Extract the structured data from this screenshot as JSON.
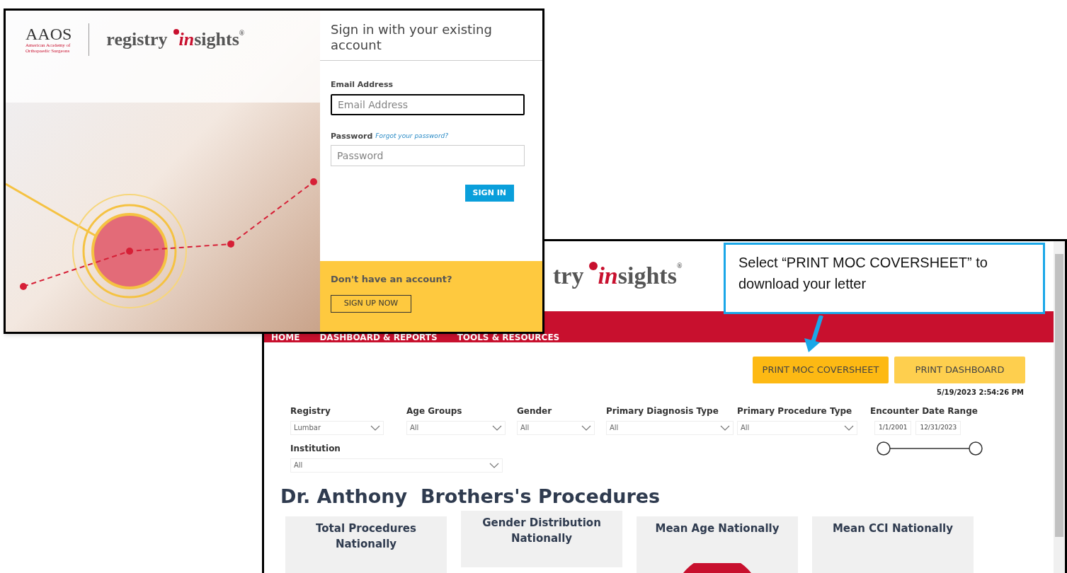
{
  "login_window": {
    "logo": {
      "org": "AAOS",
      "org_lines": [
        "American Academy of",
        "Orthopaedic Surgeons"
      ],
      "product": [
        "registry",
        "in",
        "sights"
      ],
      "mark": "®"
    },
    "title": "Sign in with your existing account",
    "email": {
      "label": "Email Address",
      "placeholder": "Email Address",
      "focused": true
    },
    "password": {
      "label": "Password",
      "link": "Forgot your password?",
      "placeholder": "Password",
      "focused": false
    },
    "sign_in_button": "SIGN IN",
    "signup": {
      "prompt": "Don't have an account?",
      "button": "SIGN UP NOW"
    }
  },
  "dashboard_window": {
    "logo": {
      "product": [
        "try",
        "in",
        "sights"
      ],
      "mark": "®"
    },
    "nav": [
      {
        "label": "HOME"
      },
      {
        "label": "DASHBOARD & REPORTS"
      },
      {
        "label": "TOOLS & RESOURCES"
      }
    ],
    "buttons": [
      {
        "label": "PRINT MOC COVERSHEET",
        "selected": true
      },
      {
        "label": "PRINT DASHBOARD",
        "selected": false
      }
    ],
    "timestamp": "5/19/2023 2:54:26 PM",
    "filters": [
      {
        "label": "Registry",
        "value": "Lumbar"
      },
      {
        "label": "Age Groups",
        "value": "All"
      },
      {
        "label": "Gender",
        "value": "All"
      },
      {
        "label": "Primary Diagnosis Type",
        "value": "All"
      },
      {
        "label": "Primary Procedure Type",
        "value": "All"
      }
    ],
    "date_range": {
      "label": "Encounter Date Range",
      "start": "1/1/2001",
      "end": "12/31/2023",
      "handles": [
        {
          "level": 0
        },
        {
          "level": 1
        }
      ]
    },
    "institution": {
      "label": "Institution",
      "value": "All"
    },
    "heading": "Dr. Anthony  Brothers's Procedures",
    "cards": [
      {
        "title": "Total Procedures Nationally",
        "kind": "text"
      },
      {
        "title": "Gender Distribution Nationally",
        "kind": "text"
      },
      {
        "title": "Mean Age Nationally",
        "kind": "gauge"
      },
      {
        "title": "Mean CCI Nationally",
        "kind": "text"
      }
    ]
  },
  "callout": {
    "text": "Select “PRINT MOC COVERSHEET” to download your letter"
  }
}
